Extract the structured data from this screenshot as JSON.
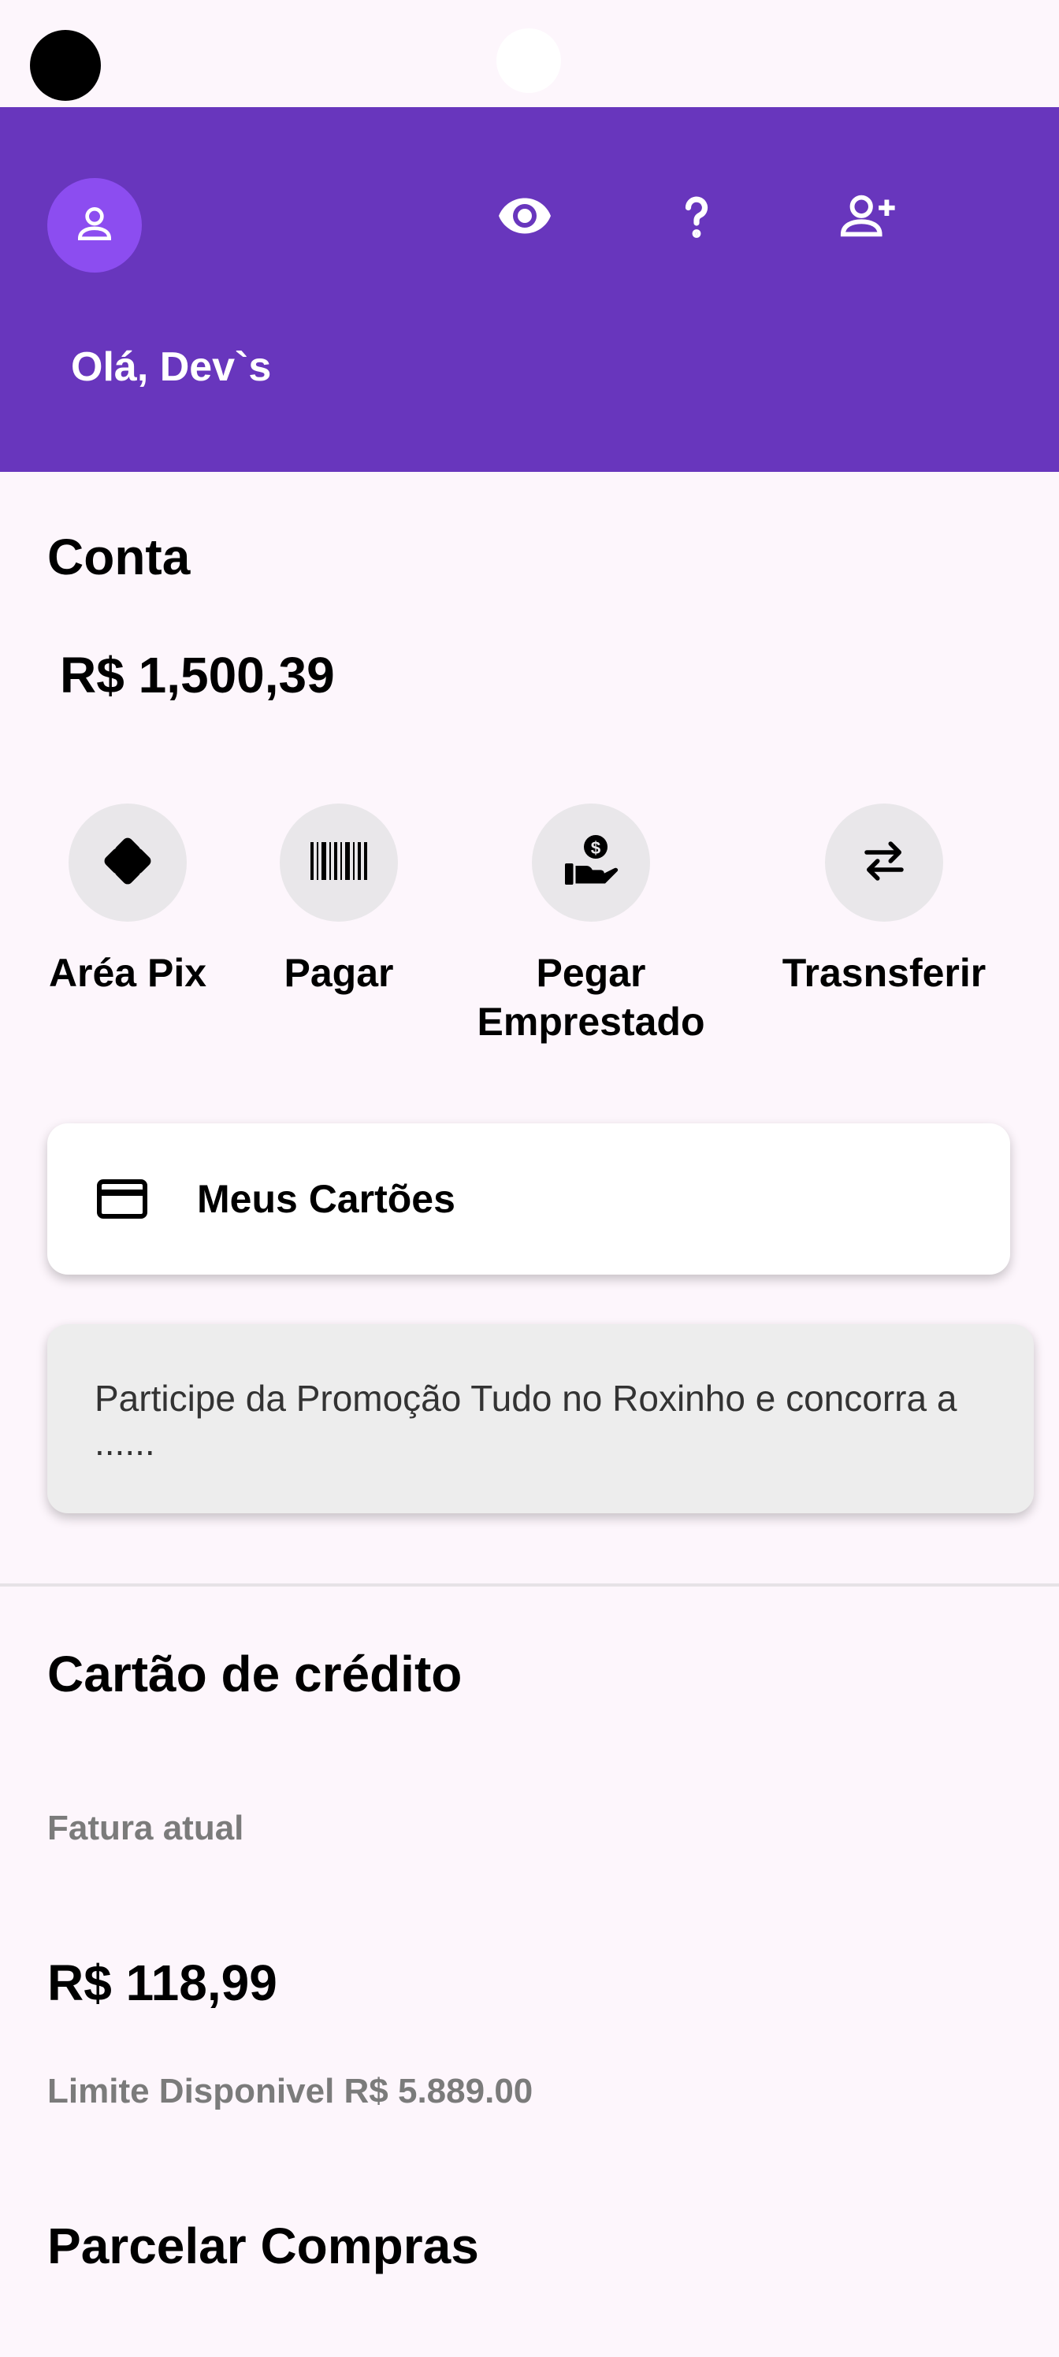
{
  "header": {
    "greeting": "Olá, Dev`s",
    "icons": [
      "person-icon",
      "eye-icon",
      "help-icon",
      "add-person-icon"
    ]
  },
  "account": {
    "title": "Conta",
    "balance": "R$ 1,500,39"
  },
  "actions": [
    {
      "label": "Aréa Pix",
      "icon": "pix-icon"
    },
    {
      "label": "Pagar",
      "icon": "barcode-icon"
    },
    {
      "label": "Pegar Emprestado",
      "icon": "loan-icon"
    },
    {
      "label": "Trasnsferir",
      "icon": "transfer-icon"
    }
  ],
  "cards_button": {
    "label": "Meus Cartões",
    "icon": "credit-card-icon"
  },
  "promo": {
    "text": "Participe da Promoção Tudo no Roxinho e concorra a ......"
  },
  "credit": {
    "title": "Cartão de crédito",
    "invoice_label": "Fatura atual",
    "amount": "R$ 118,99",
    "limit": "Limite Disponivel R$ 5.889.00"
  },
  "installments": {
    "title": "Parcelar Compras"
  },
  "colors": {
    "brand": "#6836bd",
    "avatar": "#8c4df0",
    "background": "#fdf6fc"
  }
}
